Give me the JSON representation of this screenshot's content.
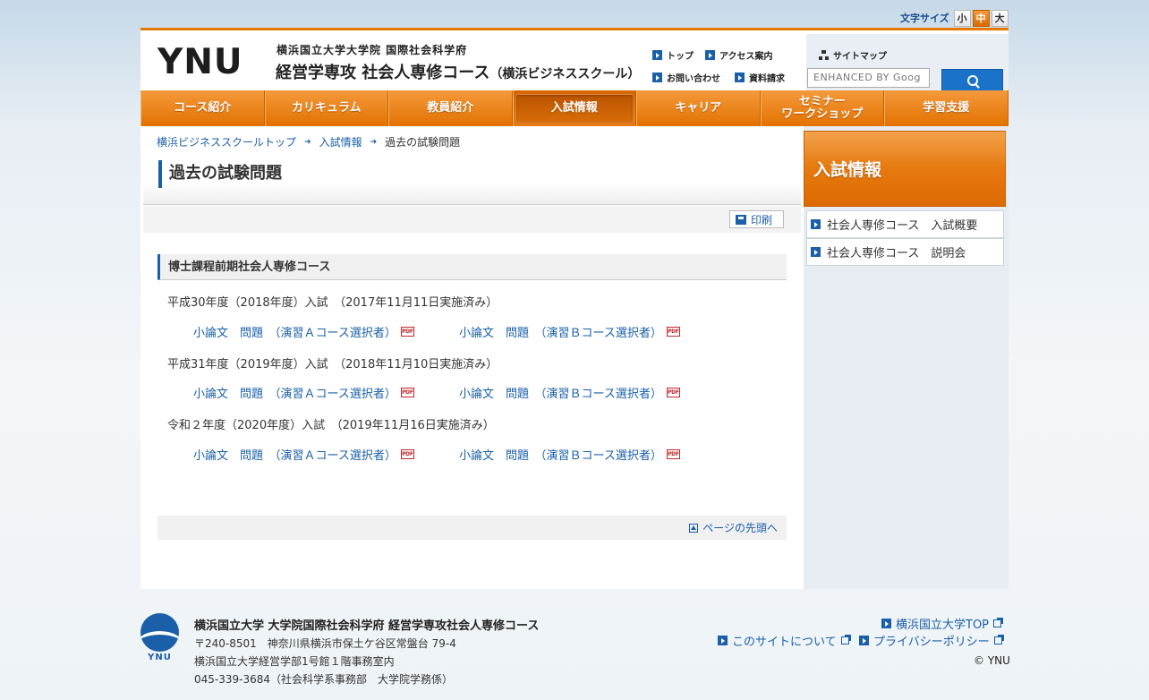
{
  "font_size": {
    "label": "文字サイズ",
    "options": [
      "小",
      "中",
      "大"
    ],
    "selected": "中"
  },
  "header": {
    "logo_text": "YNU",
    "logo_sub": "横浜国立大学大学院 国際社会科学府",
    "logo_main": "経営学専攻 社会人専修コース",
    "logo_main_suffix": "（横浜ビジネススクール）",
    "links": {
      "top": "トップ",
      "access": "アクセス案内",
      "contact": "お問い合わせ",
      "request": "資料請求",
      "sitemap": "サイトマップ"
    },
    "search_placeholder": "ENHANCED BY Goog"
  },
  "nav": {
    "items": [
      "コース紹介",
      "カリキュラム",
      "教員紹介",
      "入試情報",
      "キャリア",
      "セミナー\nワークショップ",
      "学習支援"
    ],
    "active": "入試情報"
  },
  "breadcrumb": {
    "home": "横浜ビジネススクールトップ",
    "parent": "入試情報",
    "current": "過去の試験問題"
  },
  "page_title": "過去の試験問題",
  "print_label": "印刷",
  "section_title": "博士課程前期社会人専修コース",
  "exams": [
    {
      "year": "平成30年度（2018年度）入試　（2017年11月11日実施済み）",
      "link_a": "小論文　問題　（演習Ａコース選択者）",
      "link_b": "小論文　問題　（演習Ｂコース選択者）"
    },
    {
      "year": "平成31年度（2019年度）入試　（2018年11月10日実施済み）",
      "link_a": "小論文　問題　（演習Ａコース選択者）",
      "link_b": "小論文　問題　（演習Ｂコース選択者）"
    },
    {
      "year": "令和２年度（2020年度）入試　（2019年11月16日実施済み）",
      "link_a": "小論文　問題　（演習Ａコース選択者）",
      "link_b": "小論文　問題　（演習Ｂコース選択者）"
    }
  ],
  "pdf_label": "PDF",
  "page_top": "ページの先頭へ",
  "side": {
    "title": "入試情報",
    "items": [
      "社会人専修コース　入試概要",
      "社会人専修コース　説明会"
    ]
  },
  "footer": {
    "logo_text": "YNU",
    "name": "横浜国立大学 大学院国際社会科学府 経営学専攻社会人専修コース",
    "address": "〒240-8501　神奈川県横浜市保土ケ谷区常盤台 79-4",
    "building": "横浜国立大学経営学部1号館１階事務室内",
    "phone": "045-339-3684（社会科学系事務部　大学院学務係）",
    "links": {
      "ynu_top": "横浜国立大学TOP",
      "about": "このサイトについて",
      "privacy": "プライバシーポリシー"
    },
    "copyright": "© YNU"
  },
  "colors": {
    "accent_orange": "#e57800",
    "link_blue": "#1a5fa8"
  }
}
